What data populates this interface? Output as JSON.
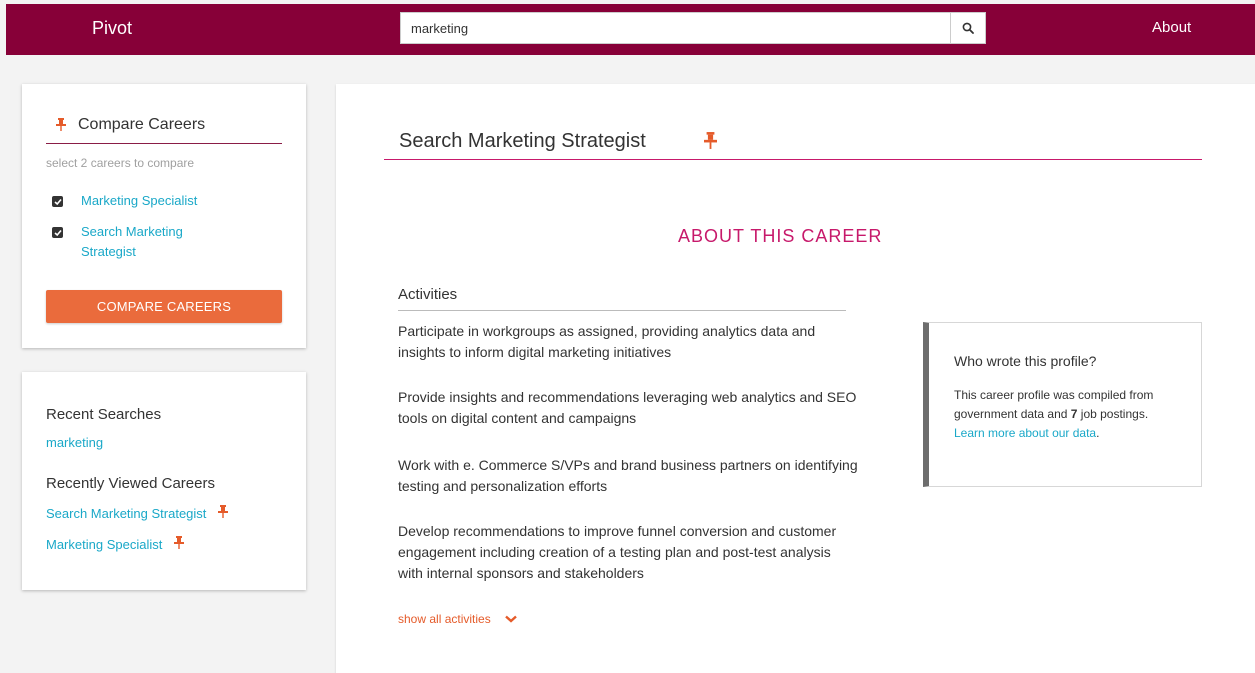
{
  "header": {
    "brand": "Pivot",
    "search_value": "marketing",
    "about": "About"
  },
  "compare": {
    "title": "Compare Careers",
    "hint": "select 2 careers to compare",
    "items": [
      {
        "label": "Marketing Specialist",
        "checked": true
      },
      {
        "label": "Search Marketing Strategist",
        "checked": true
      }
    ],
    "button": "COMPARE CAREERS"
  },
  "recent": {
    "searches_heading": "Recent Searches",
    "searches": [
      "marketing"
    ],
    "viewed_heading": "Recently Viewed Careers",
    "viewed": [
      "Search Marketing Strategist",
      "Marketing Specialist"
    ]
  },
  "career": {
    "title": "Search Marketing Strategist",
    "section": "ABOUT THIS CAREER",
    "activities_heading": "Activities",
    "activities": [
      "Participate in workgroups as assigned, providing analytics data and insights to inform digital marketing initiatives",
      "Provide insights and recommendations leveraging web analytics and SEO tools on digital content and campaigns",
      "Work with e. Commerce S/VPs and brand business partners on identifying testing and personalization efforts",
      "Develop recommendations to improve funnel conversion and customer engagement including creation of a testing plan and post-test analysis with internal sponsors and stakeholders"
    ],
    "show_all": "show all activities"
  },
  "profile": {
    "question": "Who wrote this profile?",
    "text_before": "This career profile was compiled from government data and ",
    "count": "7",
    "text_after": " job postings.",
    "link": "Learn more about our data",
    "link_suffix": "."
  },
  "colors": {
    "header_bg": "#870038",
    "accent_orange": "#ea6b3c",
    "link_teal": "#1aa8c8",
    "title_magenta": "#c7196b"
  },
  "icons": {
    "pin": "pin-icon",
    "search": "search-icon",
    "check": "check-icon",
    "chevron": "chevron-down-icon"
  }
}
